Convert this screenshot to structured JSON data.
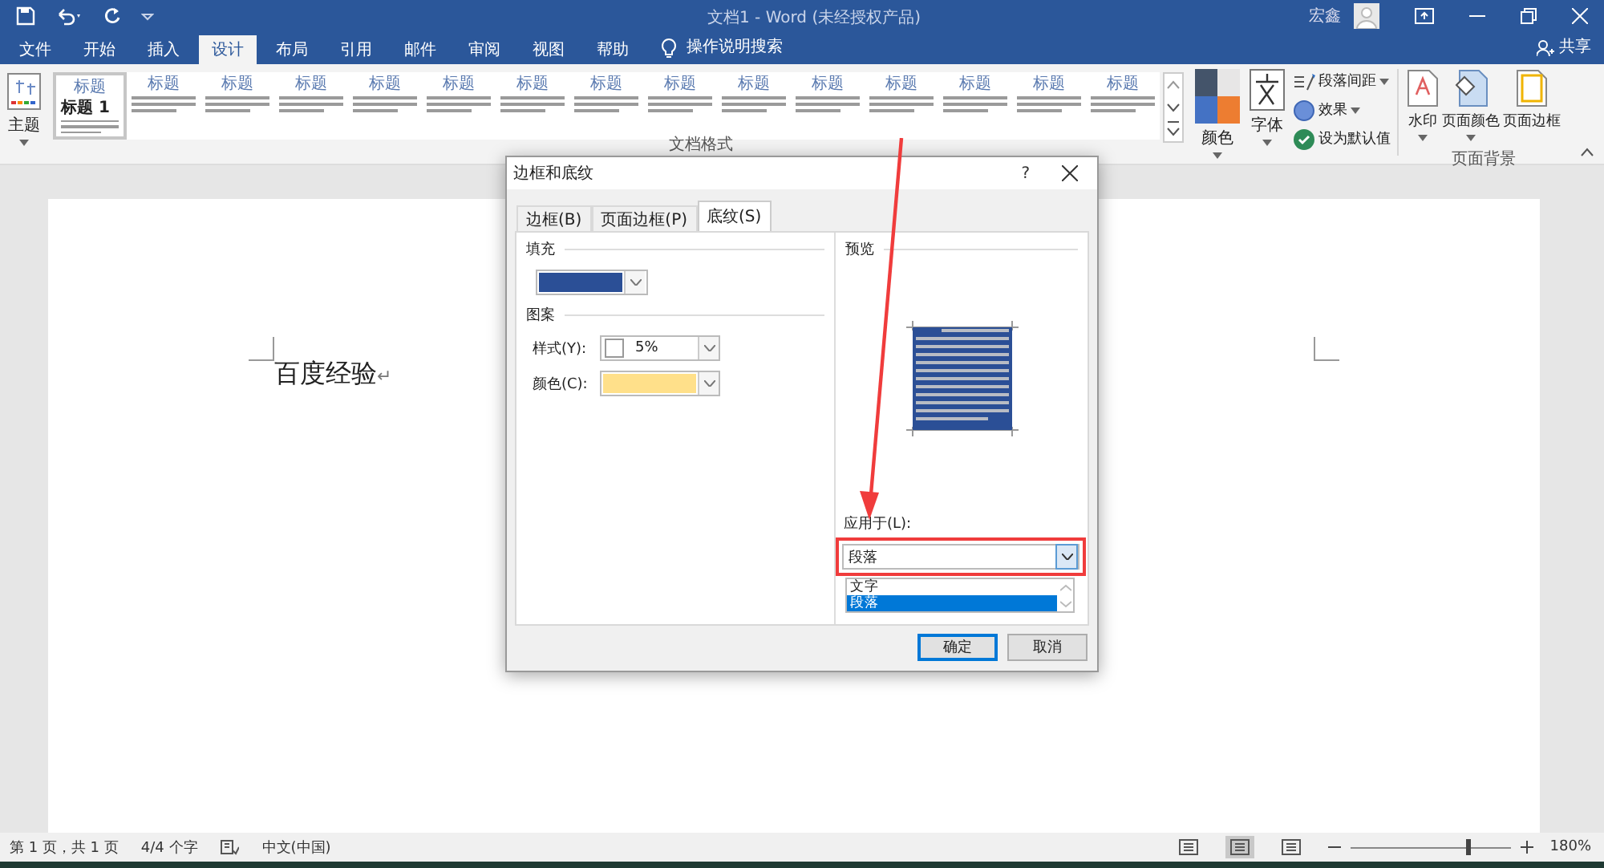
{
  "title_bar": {
    "title": "文档1 - Word (未经授权产品)",
    "user": "宏鑫"
  },
  "menu_tabs": [
    {
      "label": "文件",
      "selected": false
    },
    {
      "label": "开始",
      "selected": false
    },
    {
      "label": "插入",
      "selected": false
    },
    {
      "label": "设计",
      "selected": true
    },
    {
      "label": "布局",
      "selected": false
    },
    {
      "label": "引用",
      "selected": false
    },
    {
      "label": "邮件",
      "selected": false
    },
    {
      "label": "审阅",
      "selected": false
    },
    {
      "label": "视图",
      "selected": false
    },
    {
      "label": "帮助",
      "selected": false
    }
  ],
  "search_hint": "操作说明搜索",
  "share": "共享",
  "ribbon": {
    "theme_button": "主题",
    "gallery": [
      {
        "title": "标题",
        "heading": "标题 1",
        "selected": true
      },
      {
        "title": "标题",
        "selected": false
      },
      {
        "title": "标题",
        "selected": false
      },
      {
        "title": "标题",
        "selected": false
      },
      {
        "title": "标题",
        "selected": false
      },
      {
        "title": "标题",
        "selected": false
      },
      {
        "title": "标题",
        "selected": false
      },
      {
        "title": "标题",
        "selected": false
      },
      {
        "title": "标题",
        "selected": false
      },
      {
        "title": "标题",
        "selected": false
      },
      {
        "title": "标题",
        "selected": false
      },
      {
        "title": "标题",
        "selected": false
      },
      {
        "title": "标题",
        "selected": false
      },
      {
        "title": "标题",
        "selected": false
      },
      {
        "title": "标题",
        "selected": false
      }
    ],
    "colors_button": "颜色",
    "fonts_button": "字体",
    "small_buttons": [
      {
        "label": "段落间距",
        "kind": "spacing",
        "dropdown": true
      },
      {
        "label": "效果",
        "kind": "effects",
        "dropdown": true
      },
      {
        "label": "设为默认值",
        "kind": "default",
        "dropdown": false
      }
    ],
    "format_group_label": "文档格式",
    "background_buttons": [
      {
        "label": "水印",
        "kind": "watermark",
        "dropdown": true
      },
      {
        "label": "页面颜色",
        "kind": "color",
        "dropdown": true
      },
      {
        "label": "页面边框",
        "kind": "border",
        "dropdown": false
      }
    ],
    "background_group_label": "页面背景"
  },
  "document": {
    "text": "百度经验",
    "paragraph_mark": "↵"
  },
  "dialog": {
    "title": "边框和底纹",
    "help": "?",
    "tabs": [
      {
        "label": "边框(B)",
        "selected": false
      },
      {
        "label": "页面边框(P)",
        "selected": false
      },
      {
        "label": "底纹(S)",
        "selected": true
      }
    ],
    "fill_label": "填充",
    "pattern_label": "图案",
    "style_label": "样式(Y):",
    "style_value": "5%",
    "color_label": "颜色(C):",
    "preview_label": "预览",
    "apply_label": "应用于(L):",
    "apply_value": "段落",
    "apply_options": [
      {
        "label": "文字",
        "selected": false
      },
      {
        "label": "段落",
        "selected": true
      }
    ],
    "buttons": [
      {
        "label": "确定",
        "default": true
      },
      {
        "label": "取消",
        "default": false
      }
    ]
  },
  "status_bar": {
    "page": "第 1 页，共 1 页",
    "words": "4/4 个字",
    "language": "中文(中国)",
    "views": [
      {
        "selected": false
      },
      {
        "selected": true
      },
      {
        "selected": false
      }
    ],
    "zoom": {
      "level": 0.72,
      "reading": "180%"
    }
  }
}
